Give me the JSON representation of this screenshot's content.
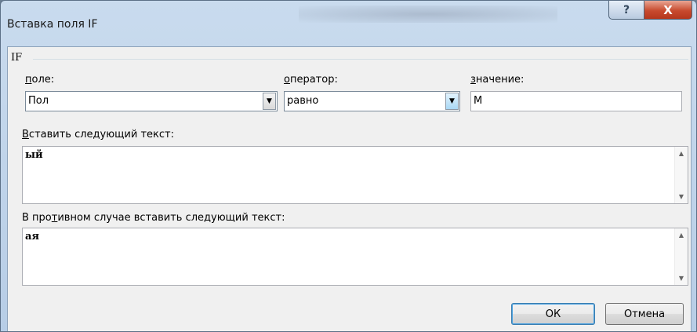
{
  "window": {
    "title": "Вставка поля IF",
    "help_glyph": "?",
    "close_glyph": "X"
  },
  "group": {
    "label": "IF"
  },
  "field": {
    "label_accel": "п",
    "label_rest": "оле:",
    "value": "Пол",
    "arrow_icon": "chevron-down-icon"
  },
  "operator": {
    "label_accel": "о",
    "label_rest": "ператор:",
    "value": "равно",
    "arrow_icon": "chevron-down-icon"
  },
  "comparison": {
    "label_accel": "з",
    "label_rest": "начение:",
    "value": "М"
  },
  "true_text": {
    "label_accel": "В",
    "label_rest": "ставить следующий текст:",
    "value": "ый"
  },
  "false_text": {
    "label_pre": "В про",
    "label_accel": "т",
    "label_rest": "ивном случае вставить следующий текст:",
    "value": "ая"
  },
  "buttons": {
    "ok": "ОК",
    "cancel": "Отмена"
  },
  "glyphs": {
    "down": "▼",
    "up": "▲"
  }
}
